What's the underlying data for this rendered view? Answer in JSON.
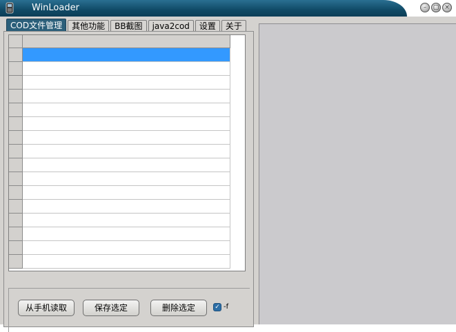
{
  "window": {
    "title": "WinLoader",
    "controls": {
      "minimize": "–",
      "maximize": "▢",
      "close": "×"
    }
  },
  "tabs": [
    "COD文件管理",
    "其他功能",
    "BB截图",
    "java2cod",
    "设置",
    "关于"
  ],
  "active_tab": 0,
  "list": {
    "row_count": 16,
    "selected_row": 0
  },
  "buttons": {
    "read_from_phone": "从手机读取",
    "save_selected": "保存选定",
    "delete_selected": "删除选定"
  },
  "checkbox": {
    "label": "-f",
    "checked": true
  },
  "colors": {
    "title_bar": "#104a66",
    "active_tab": "#2b5f7a",
    "selection": "#3399ff",
    "window_bg": "#d4d2cf",
    "right_panel": "#cbcacd"
  }
}
